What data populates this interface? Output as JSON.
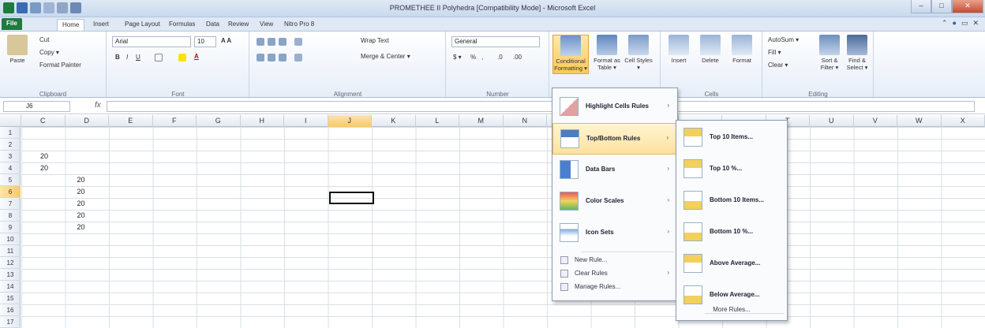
{
  "window": {
    "title": "PROMETHEE II Polyhedra [Compatibility Mode] - Microsoft Excel",
    "minimize": "–",
    "maximize": "□",
    "close": "✕"
  },
  "tabs": [
    {
      "label": "File"
    },
    {
      "label": "Home"
    },
    {
      "label": "Insert"
    },
    {
      "label": "Page Layout"
    },
    {
      "label": "Formulas"
    },
    {
      "label": "Data"
    },
    {
      "label": "Review"
    },
    {
      "label": "View"
    },
    {
      "label": "Nitro Pro 8"
    }
  ],
  "ribbon": {
    "clipboard": {
      "label": "Clipboard",
      "paste": "Paste",
      "cut": "Cut",
      "copy": "Copy ▾",
      "format_painter": "Format Painter"
    },
    "font": {
      "label": "Font",
      "name": "Arial",
      "size": "10"
    },
    "alignment": {
      "label": "Alignment",
      "wrap": "Wrap Text",
      "merge": "Merge & Center ▾"
    },
    "number": {
      "label": "Number",
      "format": "General"
    },
    "styles": {
      "conditional": "Conditional Formatting ▾",
      "format_table": "Format as Table ▾",
      "cell_styles": "Cell Styles ▾"
    },
    "cells": {
      "label": "Cells",
      "insert": "Insert",
      "delete": "Delete",
      "format": "Format"
    },
    "editing": {
      "label": "Editing",
      "autosum": "AutoSum ▾",
      "fill": "Fill ▾",
      "clear": "Clear ▾",
      "sort": "Sort & Filter ▾",
      "find": "Find & Select ▾"
    }
  },
  "formula_bar": {
    "name_box": "J6",
    "fx": "fx",
    "value": ""
  },
  "columns": [
    "C",
    "D",
    "E",
    "F",
    "G",
    "H",
    "I",
    "J",
    "K",
    "L",
    "M",
    "N",
    "",
    "",
    "",
    "",
    "",
    "T",
    "U",
    "V",
    "W",
    "X"
  ],
  "rows": [
    "1",
    "2",
    "3",
    "4",
    "5",
    "6",
    "7",
    "8",
    "9",
    "10",
    "11",
    "12",
    "13",
    "14",
    "15",
    "16",
    "17"
  ],
  "cells": [
    {
      "row": "3",
      "col": "C",
      "value": "20"
    },
    {
      "row": "4",
      "col": "C",
      "value": "20"
    },
    {
      "row": "5",
      "col": "D",
      "value": "20"
    },
    {
      "row": "6",
      "col": "D",
      "value": "20"
    },
    {
      "row": "7",
      "col": "D",
      "value": "20"
    },
    {
      "row": "8",
      "col": "D",
      "value": "20"
    },
    {
      "row": "9",
      "col": "D",
      "value": "20"
    }
  ],
  "active_cell": "J6",
  "cf_menu": {
    "items": [
      {
        "label": "Highlight Cells Rules"
      },
      {
        "label": "Top/Bottom Rules"
      },
      {
        "label": "Data Bars"
      },
      {
        "label": "Color Scales"
      },
      {
        "label": "Icon Sets"
      }
    ],
    "small_items": [
      {
        "label": "New Rule..."
      },
      {
        "label": "Clear Rules"
      },
      {
        "label": "Manage Rules..."
      }
    ]
  },
  "topbottom_menu": {
    "items": [
      {
        "label": "Top 10 Items..."
      },
      {
        "label": "Top 10 %..."
      },
      {
        "label": "Bottom 10 Items..."
      },
      {
        "label": "Bottom 10 %..."
      },
      {
        "label": "Above Average..."
      },
      {
        "label": "Below Average..."
      }
    ],
    "more": "More Rules..."
  },
  "icons": {
    "arrow": "›"
  }
}
